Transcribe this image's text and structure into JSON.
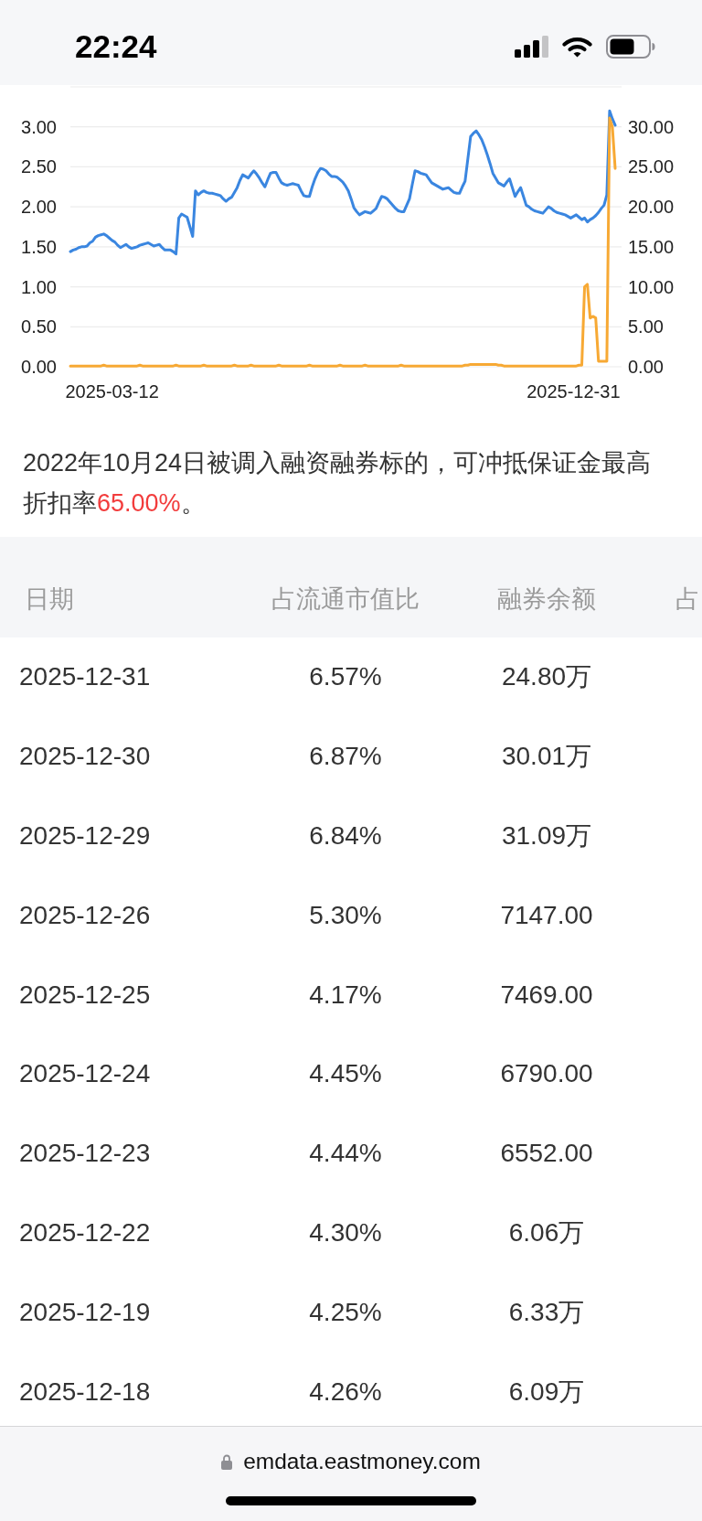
{
  "status_bar": {
    "time": "22:24"
  },
  "chart": {
    "chart_data": {
      "type": "line",
      "grid": true,
      "categories": [
        null,
        null,
        null,
        null,
        null,
        null,
        null,
        null,
        null,
        null,
        null,
        null,
        null,
        null,
        null,
        "2025-03-12",
        null,
        null,
        null,
        null,
        null,
        null,
        null,
        null,
        null,
        null,
        null,
        null,
        null,
        null,
        null,
        null,
        null,
        null,
        null,
        null,
        null,
        null,
        null,
        null,
        null,
        null,
        null,
        null,
        null,
        null,
        null,
        null,
        null,
        null,
        null,
        null,
        null,
        null,
        null,
        null,
        null,
        null,
        null,
        null,
        null,
        null,
        null,
        null,
        null,
        null,
        null,
        null,
        null,
        null,
        null,
        null,
        null,
        null,
        null,
        null,
        null,
        null,
        null,
        null,
        null,
        null,
        null,
        null,
        null,
        null,
        null,
        null,
        null,
        null,
        null,
        null,
        null,
        null,
        null,
        null,
        null,
        null,
        null,
        null,
        null,
        null,
        null,
        null,
        null,
        null,
        null,
        null,
        null,
        null,
        null,
        null,
        null,
        null,
        null,
        null,
        null,
        null,
        null,
        null,
        null,
        null,
        null,
        null,
        null,
        null,
        null,
        null,
        null,
        null,
        null,
        null,
        null,
        null,
        null,
        null,
        null,
        null,
        null,
        null,
        null,
        null,
        null,
        null,
        null,
        null,
        null,
        null,
        null,
        null,
        null,
        null,
        null,
        null,
        null,
        null,
        null,
        null,
        null,
        null,
        null,
        null,
        null,
        null,
        null,
        null,
        null,
        null,
        null,
        null,
        null,
        null,
        null,
        null,
        null,
        null,
        null,
        null,
        null,
        null,
        null,
        "2025-12-31",
        null,
        null,
        null,
        null,
        null,
        null,
        null,
        null,
        null,
        null,
        null,
        null,
        null,
        null,
        null
      ],
      "ylim": [
        0,
        3.5
      ],
      "yticks": [
        {
          "value": 0,
          "label": "0.00"
        },
        {
          "value": 0.5,
          "label": "0.50"
        },
        {
          "value": 1,
          "label": "1.00"
        },
        {
          "value": 1.5,
          "label": "1.50"
        },
        {
          "value": 2,
          "label": "2.00"
        },
        {
          "value": 2.5,
          "label": "2.50"
        },
        {
          "value": 3,
          "label": "3.00"
        }
      ],
      "y2lim": [
        0,
        35
      ],
      "y2ticks": [
        {
          "value": 0,
          "label": "0.00"
        },
        {
          "value": 5,
          "label": "5.00"
        },
        {
          "value": 10,
          "label": "10.00"
        },
        {
          "value": 15,
          "label": "15.00"
        },
        {
          "value": 20,
          "label": "20.00"
        },
        {
          "value": 25,
          "label": "25.00"
        },
        {
          "value": 30,
          "label": "30.00"
        }
      ],
      "series": [
        {
          "color": "#3a86e0",
          "values": [
            1.44,
            1.46,
            1.47,
            1.49,
            1.5,
            1.5,
            1.51,
            1.55,
            1.57,
            1.62,
            1.64,
            1.65,
            1.66,
            1.64,
            1.61,
            1.58,
            1.56,
            1.52,
            1.49,
            1.51,
            1.53,
            1.5,
            1.48,
            1.49,
            1.5,
            1.52,
            1.53,
            1.54,
            1.55,
            1.53,
            1.51,
            1.52,
            1.53,
            1.49,
            1.46,
            1.46,
            1.46,
            1.44,
            1.41,
            1.86,
            1.91,
            1.89,
            1.87,
            1.75,
            1.63,
            2.2,
            2.15,
            2.18,
            2.2,
            2.18,
            2.17,
            2.17,
            2.16,
            2.15,
            2.14,
            2.1,
            2.07,
            2.1,
            2.12,
            2.18,
            2.24,
            2.33,
            2.4,
            2.38,
            2.36,
            2.41,
            2.45,
            2.41,
            2.36,
            2.3,
            2.25,
            2.34,
            2.42,
            2.43,
            2.43,
            2.36,
            2.3,
            2.28,
            2.27,
            2.28,
            2.29,
            2.28,
            2.27,
            2.2,
            2.14,
            2.13,
            2.13,
            2.25,
            2.35,
            2.43,
            2.48,
            2.47,
            2.45,
            2.41,
            2.38,
            2.38,
            2.37,
            2.34,
            2.31,
            2.26,
            2.2,
            2.1,
            1.99,
            1.94,
            1.9,
            1.92,
            1.94,
            1.93,
            1.92,
            1.95,
            1.98,
            2.06,
            2.13,
            2.12,
            2.1,
            2.06,
            2.02,
            1.98,
            1.95,
            1.94,
            1.94,
            2.02,
            2.1,
            2.28,
            2.45,
            2.44,
            2.42,
            2.41,
            2.4,
            2.35,
            2.3,
            2.28,
            2.26,
            2.24,
            2.22,
            2.23,
            2.24,
            2.21,
            2.18,
            2.17,
            2.17,
            2.25,
            2.32,
            2.6,
            2.88,
            2.92,
            2.95,
            2.9,
            2.84,
            2.75,
            2.65,
            2.54,
            2.42,
            2.36,
            2.3,
            2.28,
            2.26,
            2.31,
            2.35,
            2.24,
            2.13,
            2.19,
            2.24,
            2.13,
            2.02,
            2.0,
            1.97,
            1.95,
            1.94,
            1.93,
            1.92,
            1.96,
            2.0,
            1.98,
            1.95,
            1.93,
            1.92,
            1.91,
            1.9,
            1.88,
            1.86,
            1.88,
            1.9,
            1.87,
            1.84,
            1.86,
            1.81,
            1.84,
            1.86,
            1.89,
            1.93,
            1.98,
            2.02,
            2.15,
            3.2,
            3.1,
            3.02
          ]
        },
        {
          "color": "#f7a934",
          "axis": "y2",
          "values": [
            0.1,
            0.1,
            0.1,
            0.1,
            0.1,
            0.1,
            0.1,
            0.1,
            0.1,
            0.1,
            0.1,
            0.1,
            0.2,
            0.1,
            0.1,
            0.1,
            0.1,
            0.1,
            0.1,
            0.1,
            0.1,
            0.1,
            0.1,
            0.1,
            0.1,
            0.2,
            0.1,
            0.1,
            0.1,
            0.1,
            0.1,
            0.1,
            0.1,
            0.1,
            0.1,
            0.1,
            0.1,
            0.1,
            0.2,
            0.1,
            0.1,
            0.1,
            0.1,
            0.1,
            0.1,
            0.1,
            0.1,
            0.1,
            0.2,
            0.1,
            0.1,
            0.1,
            0.1,
            0.1,
            0.1,
            0.1,
            0.1,
            0.1,
            0.1,
            0.2,
            0.1,
            0.1,
            0.1,
            0.1,
            0.1,
            0.2,
            0.1,
            0.1,
            0.1,
            0.1,
            0.1,
            0.1,
            0.1,
            0.1,
            0.1,
            0.2,
            0.1,
            0.1,
            0.1,
            0.1,
            0.1,
            0.1,
            0.1,
            0.1,
            0.1,
            0.1,
            0.2,
            0.1,
            0.1,
            0.1,
            0.1,
            0.1,
            0.1,
            0.1,
            0.1,
            0.1,
            0.1,
            0.2,
            0.1,
            0.1,
            0.1,
            0.1,
            0.1,
            0.1,
            0.1,
            0.1,
            0.2,
            0.1,
            0.1,
            0.1,
            0.1,
            0.1,
            0.1,
            0.1,
            0.1,
            0.1,
            0.1,
            0.1,
            0.1,
            0.2,
            0.1,
            0.1,
            0.1,
            0.1,
            0.1,
            0.1,
            0.1,
            0.1,
            0.1,
            0.1,
            0.1,
            0.1,
            0.1,
            0.1,
            0.1,
            0.1,
            0.1,
            0.1,
            0.1,
            0.1,
            0.1,
            0.1,
            0.2,
            0.2,
            0.3,
            0.3,
            0.3,
            0.3,
            0.3,
            0.3,
            0.3,
            0.3,
            0.3,
            0.3,
            0.2,
            0.2,
            0.1,
            0.1,
            0.1,
            0.1,
            0.1,
            0.1,
            0.1,
            0.1,
            0.1,
            0.1,
            0.1,
            0.1,
            0.1,
            0.1,
            0.1,
            0.1,
            0.1,
            0.1,
            0.1,
            0.1,
            0.1,
            0.1,
            0.1,
            0.1,
            0.1,
            0.1,
            0.1,
            0.2,
            0.2,
            10.0,
            10.3,
            6.1,
            6.3,
            6.1,
            0.7,
            0.7,
            0.7,
            0.7,
            31.1,
            30.0,
            24.8
          ]
        }
      ]
    }
  },
  "note": {
    "text": "2022年10月24日被调入融资融券标的，可冲抵保证金最高折扣率",
    "highlight": "65.00%",
    "suffix": "。"
  },
  "table": {
    "columns": [
      "日期",
      "占流通市值比",
      "融券余额",
      "占"
    ],
    "rows": [
      [
        "2025-12-31",
        "6.57%",
        "24.80万"
      ],
      [
        "2025-12-30",
        "6.87%",
        "30.01万"
      ],
      [
        "2025-12-29",
        "6.84%",
        "31.09万"
      ],
      [
        "2025-12-26",
        "5.30%",
        "7147.00"
      ],
      [
        "2025-12-25",
        "4.17%",
        "7469.00"
      ],
      [
        "2025-12-24",
        "4.45%",
        "6790.00"
      ],
      [
        "2025-12-23",
        "4.44%",
        "6552.00"
      ],
      [
        "2025-12-22",
        "4.30%",
        "6.06万"
      ],
      [
        "2025-12-19",
        "4.25%",
        "6.33万"
      ],
      [
        "2025-12-18",
        "4.26%",
        "6.09万"
      ]
    ]
  },
  "address_bar": {
    "url": "emdata.eastmoney.com"
  }
}
